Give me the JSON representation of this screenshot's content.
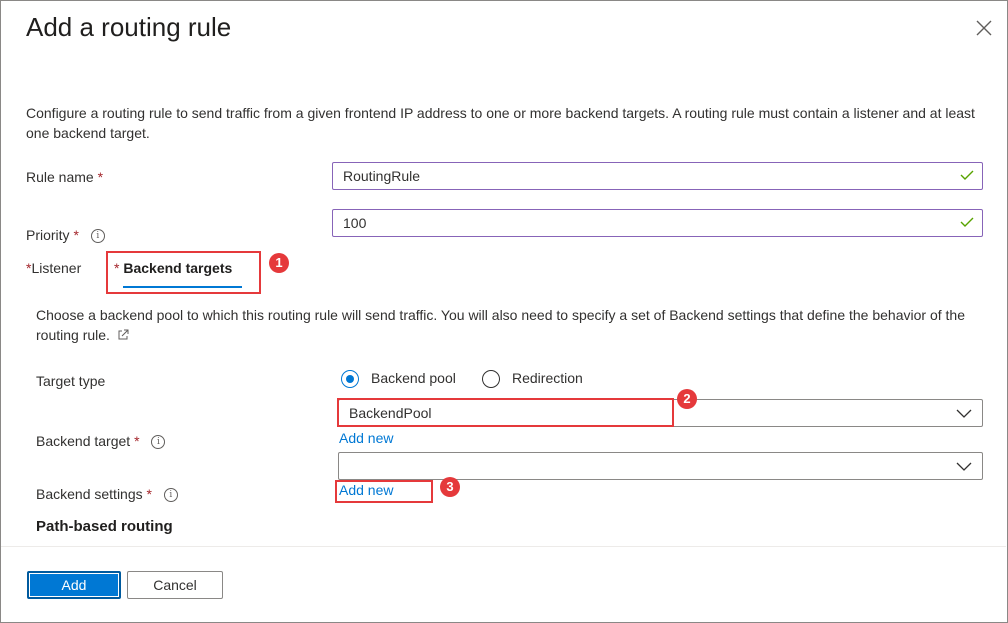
{
  "dialog": {
    "title": "Add a routing rule",
    "description": "Configure a routing rule to send traffic from a given frontend IP address to one or more backend targets. A routing rule must contain a listener and at least one backend target."
  },
  "form": {
    "rule_name": {
      "label": "Rule name",
      "required": "*",
      "value": "RoutingRule"
    },
    "priority": {
      "label": "Priority",
      "required": "*",
      "value": "100"
    }
  },
  "tabs": [
    {
      "label": "Listener",
      "required": "*"
    },
    {
      "label": "Backend targets",
      "required": "*",
      "selected": true
    }
  ],
  "backend": {
    "description": "Choose a backend pool to which this routing rule will send traffic. You will also need to specify a set of Backend settings that define the behavior of the routing rule.",
    "target_type_label": "Target type",
    "target_type_options": [
      {
        "label": "Backend pool",
        "selected": true
      },
      {
        "label": "Redirection",
        "selected": false
      }
    ],
    "backend_target": {
      "label": "Backend target",
      "required": "*",
      "value": "BackendPool",
      "add_new": "Add new"
    },
    "backend_settings": {
      "label": "Backend settings",
      "required": "*",
      "value": "",
      "add_new": "Add new"
    },
    "path_routing_heading": "Path-based routing"
  },
  "callouts": [
    "1",
    "2",
    "3"
  ],
  "footer": {
    "add_label": "Add",
    "cancel_label": "Cancel"
  },
  "colors": {
    "accent": "#0078d4",
    "callout": "#e5393b",
    "valid": "#57a300",
    "focus_border": "#8764b8"
  },
  "icons": [
    "close-icon",
    "checkmark-icon",
    "info-icon",
    "external-link-icon",
    "chevron-down-icon"
  ]
}
